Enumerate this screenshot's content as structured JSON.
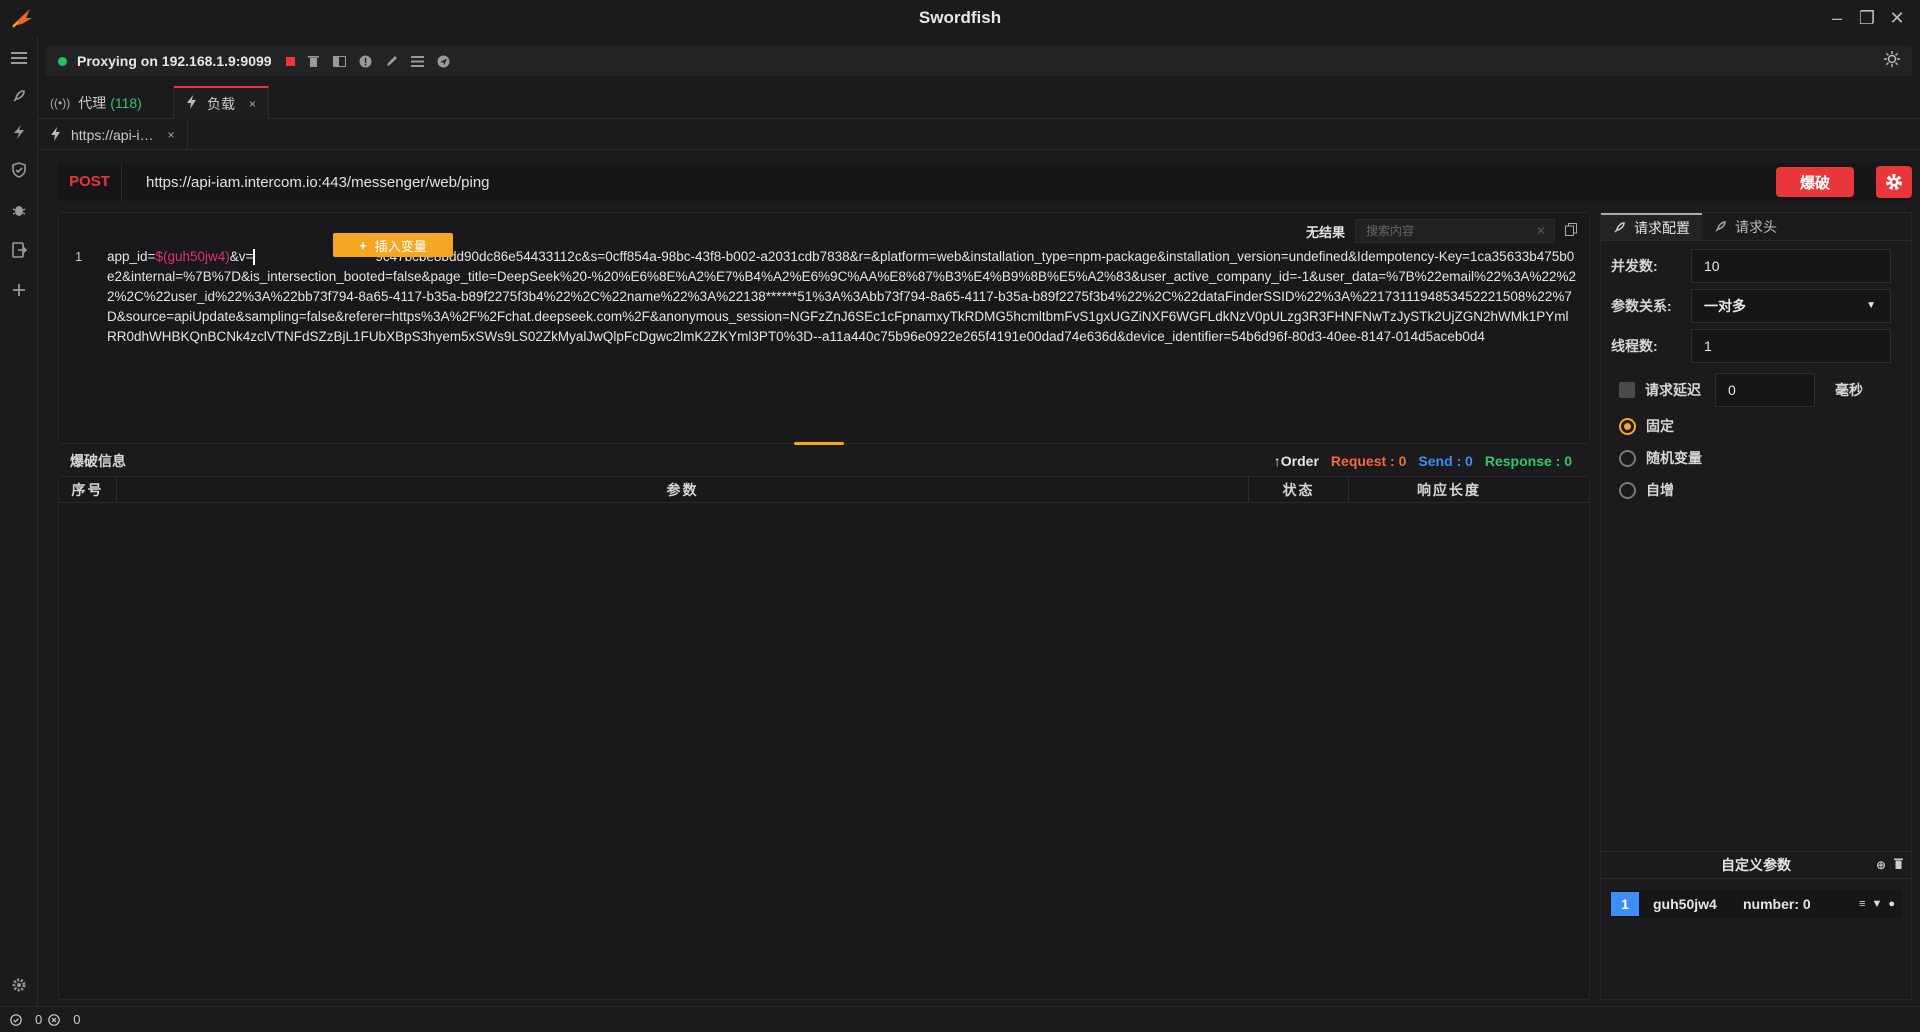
{
  "app": {
    "title": "Swordfish"
  },
  "proxy": {
    "status_text": "Proxying on 192.168.1.9:9099"
  },
  "tabs": [
    {
      "label": "代理",
      "count": "(118)"
    },
    {
      "label": "负载",
      "close": "×"
    }
  ],
  "subtab": {
    "label": "https://api-i…",
    "close": "×"
  },
  "request": {
    "method": "POST",
    "url": "https://api-iam.intercom.io:443/messenger/web/ping",
    "blast_label": "爆破"
  },
  "editor": {
    "no_result": "无结果",
    "search_placeholder": "搜索内容",
    "line_number": "1",
    "body_prefix": "app_id=",
    "body_var": "$(guh50jw4)",
    "body_after_var": "&v=",
    "body_rest": "9c47bcbe8bdd90dc86e54433112c&s=0cff854a-98bc-43f8-b002-a2031cdb7838&r=&platform=web&installation_type=npm-package&installation_version=undefined&Idempotency-Key=1ca35633b475b0e2&internal=%7B%7D&is_intersection_booted=false&page_title=DeepSeek%20-%20%E6%8E%A2%E7%B4%A2%E6%9C%AA%E8%87%B3%E4%B9%8B%E5%A2%83&user_active_company_id=-1&user_data=%7B%22email%22%3A%22%22%2C%22user_id%22%3A%22bb73f794-8a65-4117-b35a-b89f2275f3b4%22%2C%22name%22%3A%22138******51%3A%3Abb73f794-8a65-4117-b35a-b89f2275f3b4%22%2C%22dataFinderSSID%22%3A%2217311194853452221508%22%7D&source=apiUpdate&sampling=false&referer=https%3A%2F%2Fchat.deepseek.com%2F&anonymous_session=NGFzZnJ6SEc1cFpnamxyTkRDMG5hcmltbmFvS1gxUGZiNXF6WGFLdkNzV0pULzg3R3FHNFNwTzJySTk2UjZGN2hWMk1PYmlRR0dhWHBKQnBCNk4zclVTNFdSZzBjL1FUbXBpS3hyem5xSWs9LS02ZkMyalJwQlpFcDgwc2lmK2ZKYml3PT0%3D--a11a440c75b96e0922e265f4191e00dad74e636d&device_identifier=54b6d96f-80d3-40ee-8147-014d5aceb0d4",
    "insert_var_label": "插入变量"
  },
  "info": {
    "title": "爆破信息",
    "order": "Order",
    "request": "Request : 0",
    "send": "Send : 0",
    "response": "Response : 0"
  },
  "table": {
    "columns": [
      "序号",
      "参数",
      "状态",
      "响应长度"
    ]
  },
  "config": {
    "tab_config": "请求配置",
    "tab_headers": "请求头",
    "concurrency_label": "并发数:",
    "concurrency_value": "10",
    "relation_label": "参数关系:",
    "relation_value": "一对多",
    "threads_label": "线程数:",
    "threads_value": "1",
    "delay_label": "请求延迟",
    "delay_value": "0",
    "delay_unit": "毫秒",
    "opt_fixed": "固定",
    "opt_random": "随机变量",
    "opt_increment": "自增",
    "custom_title": "自定义参数",
    "param_index": "1",
    "param_name": "guh50jw4",
    "param_type": "number: 0"
  },
  "status": {
    "ok_count": "0",
    "err_count": "0"
  },
  "colors": {
    "accent": "#e8363a",
    "orange": "#f5a623",
    "green": "#33c46b",
    "blue": "#3e8ef7"
  }
}
